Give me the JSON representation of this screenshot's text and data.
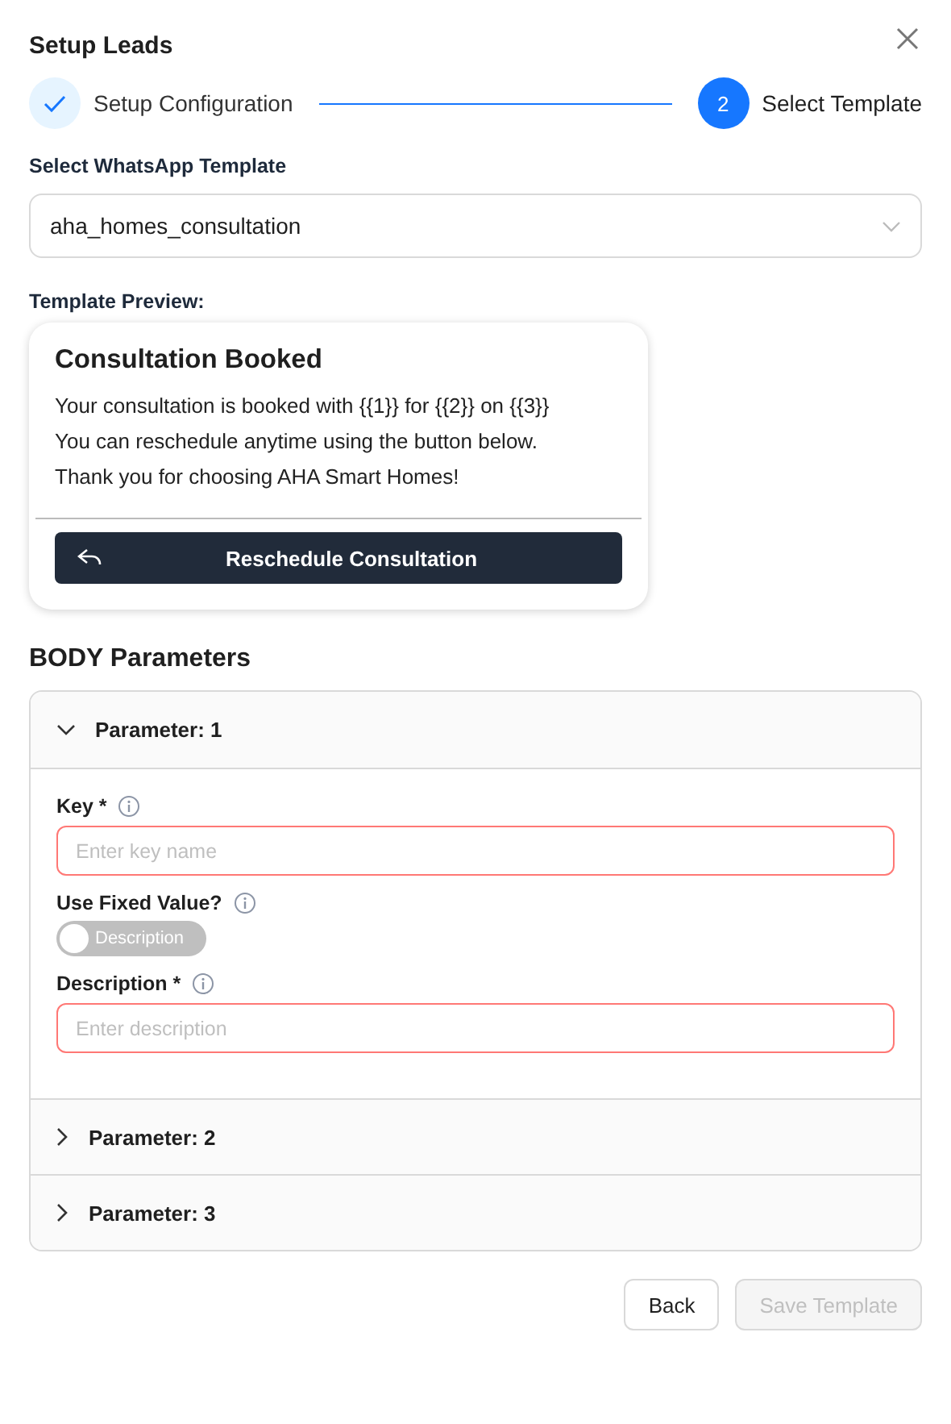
{
  "dialog": {
    "title": "Setup Leads"
  },
  "steps": [
    {
      "label": "Setup Configuration",
      "done": true,
      "selected": false
    },
    {
      "label": "Select Template",
      "number": "2",
      "done": false,
      "selected": true
    }
  ],
  "template_select": {
    "label": "Select WhatsApp Template",
    "value": "aha_homes_consultation"
  },
  "preview": {
    "label": "Template Preview:",
    "title": "Consultation Booked",
    "body_lines": [
      "Your consultation is booked with {{1}} for {{2}} on {{3}}",
      "You can reschedule anytime using the button below.",
      "Thank you for choosing AHA Smart Homes!"
    ],
    "button": "Reschedule Consultation"
  },
  "body_parameters": {
    "heading": "BODY Parameters",
    "items": [
      {
        "title": "Parameter: 1",
        "expanded": true,
        "key_label": "Key *",
        "key_placeholder": "Enter key name",
        "fixed_label": "Use Fixed Value?",
        "fixed_on": false,
        "toggle_text": "Description",
        "desc_label": "Description *",
        "desc_placeholder": "Enter description"
      },
      {
        "title": "Parameter: 2",
        "expanded": false
      },
      {
        "title": "Parameter: 3",
        "expanded": false
      }
    ]
  },
  "footer": {
    "back": "Back",
    "save": "Save Template",
    "save_disabled": true
  }
}
